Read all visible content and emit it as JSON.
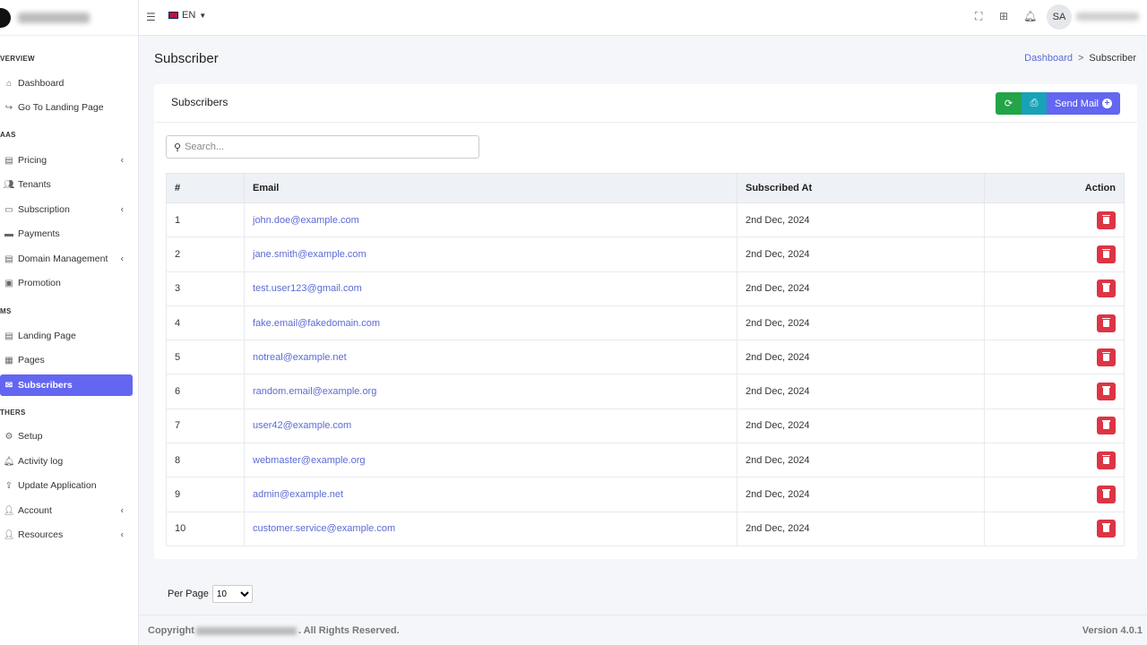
{
  "topbar": {
    "language": "EN",
    "avatar_initials": "SA"
  },
  "page": {
    "title": "Subscriber"
  },
  "breadcrumb": {
    "home": "Dashboard",
    "separator": ">",
    "current": "Subscriber"
  },
  "sidebar": {
    "sections": [
      "verview",
      "aas",
      "ms",
      "thers"
    ],
    "items": [
      {
        "label": "Dashboard",
        "icon": "home-icon"
      },
      {
        "label": "Go To Landing Page",
        "icon": "arrow-right-icon"
      },
      {
        "label": "Pricing",
        "icon": "pricing-icon",
        "chevron": true
      },
      {
        "label": "Tenants",
        "icon": "users-icon"
      },
      {
        "label": "Subscription",
        "icon": "subscription-icon",
        "chevron": true
      },
      {
        "label": "Payments",
        "icon": "payments-icon"
      },
      {
        "label": "Domain Management",
        "icon": "domain-icon",
        "chevron": true
      },
      {
        "label": "Promotion",
        "icon": "gift-icon"
      },
      {
        "label": "Landing Page",
        "icon": "landing-page-icon"
      },
      {
        "label": "Pages",
        "icon": "pages-icon"
      },
      {
        "label": "Subscribers",
        "icon": "mail-icon",
        "active": true
      },
      {
        "label": "Setup",
        "icon": "gears-icon"
      },
      {
        "label": "Activity log",
        "icon": "bell-icon"
      },
      {
        "label": "Update Application",
        "icon": "upload-icon"
      },
      {
        "label": "Account",
        "icon": "user-icon",
        "chevron": true
      },
      {
        "label": "Resources",
        "icon": "user-icon",
        "chevron": true
      }
    ]
  },
  "card": {
    "title": "Subscribers",
    "send_mail_label": "Send Mail",
    "search_placeholder": "Search..."
  },
  "table": {
    "headers": [
      "#",
      "Email",
      "Subscribed At",
      "Action"
    ],
    "rows": [
      {
        "num": "1",
        "email": "john.doe@example.com",
        "date": "2nd Dec, 2024"
      },
      {
        "num": "2",
        "email": "jane.smith@example.com",
        "date": "2nd Dec, 2024"
      },
      {
        "num": "3",
        "email": "test.user123@gmail.com",
        "date": "2nd Dec, 2024"
      },
      {
        "num": "4",
        "email": "fake.email@fakedomain.com",
        "date": "2nd Dec, 2024"
      },
      {
        "num": "5",
        "email": "notreal@example.net",
        "date": "2nd Dec, 2024"
      },
      {
        "num": "6",
        "email": "random.email@example.org",
        "date": "2nd Dec, 2024"
      },
      {
        "num": "7",
        "email": "user42@example.com",
        "date": "2nd Dec, 2024"
      },
      {
        "num": "8",
        "email": "webmaster@example.org",
        "date": "2nd Dec, 2024"
      },
      {
        "num": "9",
        "email": "admin@example.net",
        "date": "2nd Dec, 2024"
      },
      {
        "num": "10",
        "email": "customer.service@example.com",
        "date": "2nd Dec, 2024"
      }
    ]
  },
  "pagination": {
    "per_page_label": "Per Page",
    "per_page_value": "10"
  },
  "footer": {
    "copyright_prefix": "Copyright",
    "copyright_suffix": ". All Rights Reserved.",
    "version": "Version 4.0.1"
  },
  "colors": {
    "accent": "#6366f1",
    "danger": "#dc3545",
    "success": "#22a447",
    "info": "#17a2b8"
  }
}
